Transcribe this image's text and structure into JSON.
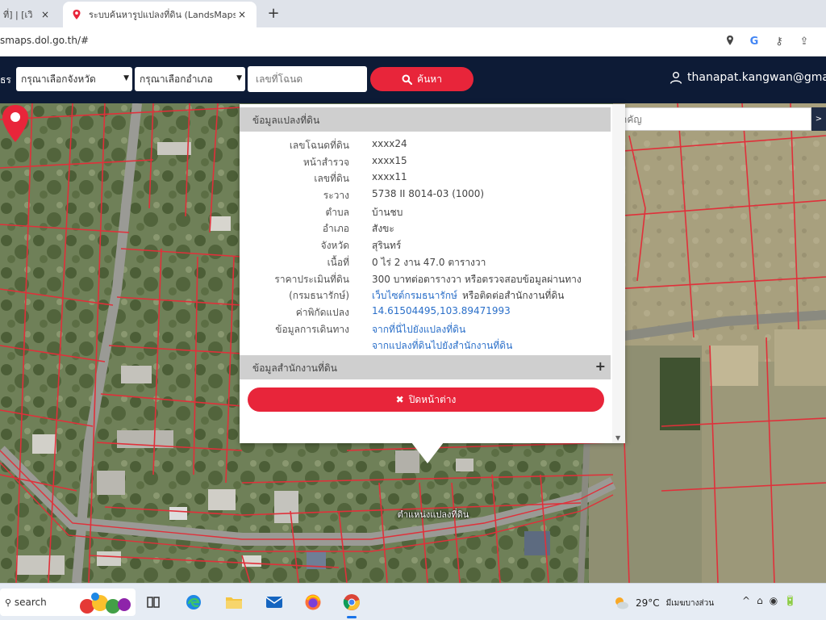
{
  "browser": {
    "tabs": [
      {
        "title": "ที่] | [เวิ"
      },
      {
        "title": "ระบบค้นหารูปแปลงที่ดิน (LandsMaps)"
      }
    ],
    "new_tab_symbol": "+",
    "close_symbol": "×",
    "url": "smaps.dol.go.th/#",
    "icons": [
      "location-icon",
      "google-icon",
      "key-icon",
      "share-icon"
    ]
  },
  "header": {
    "lead_text": "ธร",
    "province_select": "กรุณาเลือกจังหวัด",
    "district_select": "กรุณาเลือกอำเภอ",
    "deed_placeholder": "เลขที่โฉนด",
    "search_button": "ค้นหา",
    "user": "thanapat.kangwan@gma"
  },
  "map": {
    "landmark_placeholder": "ค้นหาสถานที่สำคัญ",
    "landmark_button": ">",
    "pin_label": "ตำแหน่งแปลงที่ดิน"
  },
  "popup": {
    "parcel_header": "ข้อมูลแปลงที่ดิน",
    "rows": [
      {
        "label": "เลขโฉนดที่ดิน",
        "value": "xxxx24"
      },
      {
        "label": "หน้าสำรวจ",
        "value": "xxxx15"
      },
      {
        "label": "เลขที่ดิน",
        "value": "xxxx11"
      },
      {
        "label": "ระวาง",
        "value": "5738 II 8014-03 (1000)"
      },
      {
        "label": "ตำบล",
        "value": "บ้านชบ"
      },
      {
        "label": "อำเภอ",
        "value": "สังขะ"
      },
      {
        "label": "จังหวัด",
        "value": "สุรินทร์"
      },
      {
        "label": "เนื้อที่",
        "value": "0 ไร่ 2 งาน 47.0 ตารางวา"
      },
      {
        "label": "ราคาประเมินที่ดิน",
        "value": "300 บาทต่อตารางวา หรือตรวจสอบข้อมูลผ่านทาง"
      },
      {
        "label": "(กรมธนารักษ์)",
        "value_link": "เว็บไซต์กรมธนารักษ์",
        "value_suffix": "หรือติดต่อสำนักงานที่ดิน"
      },
      {
        "label": "ค่าพิกัดแปลง",
        "value": "14.61504495,103.89471993"
      },
      {
        "label": "ข้อมูลการเดินทาง",
        "value": "จากที่นี่ไปยังแปลงที่ดิน"
      },
      {
        "label": "",
        "value": "จากแปลงที่ดินไปยังสำนักงานที่ดิน"
      }
    ],
    "office_header": "ข้อมูลสำนักงานที่ดิน",
    "office_toggle": "+",
    "close_button": "ปิดหน้าต่าง"
  },
  "taskbar": {
    "search_label": "search",
    "weather": "29°C",
    "weather_desc": "มีเมฆบางส่วน",
    "tray": [
      "^",
      "⌂",
      "◉",
      "🔋"
    ]
  },
  "colors": {
    "header_bg": "#0d1b36",
    "accent_red": "#e8253a",
    "link_blue": "#2a6fc9",
    "parcel_line": "#e0303a"
  }
}
